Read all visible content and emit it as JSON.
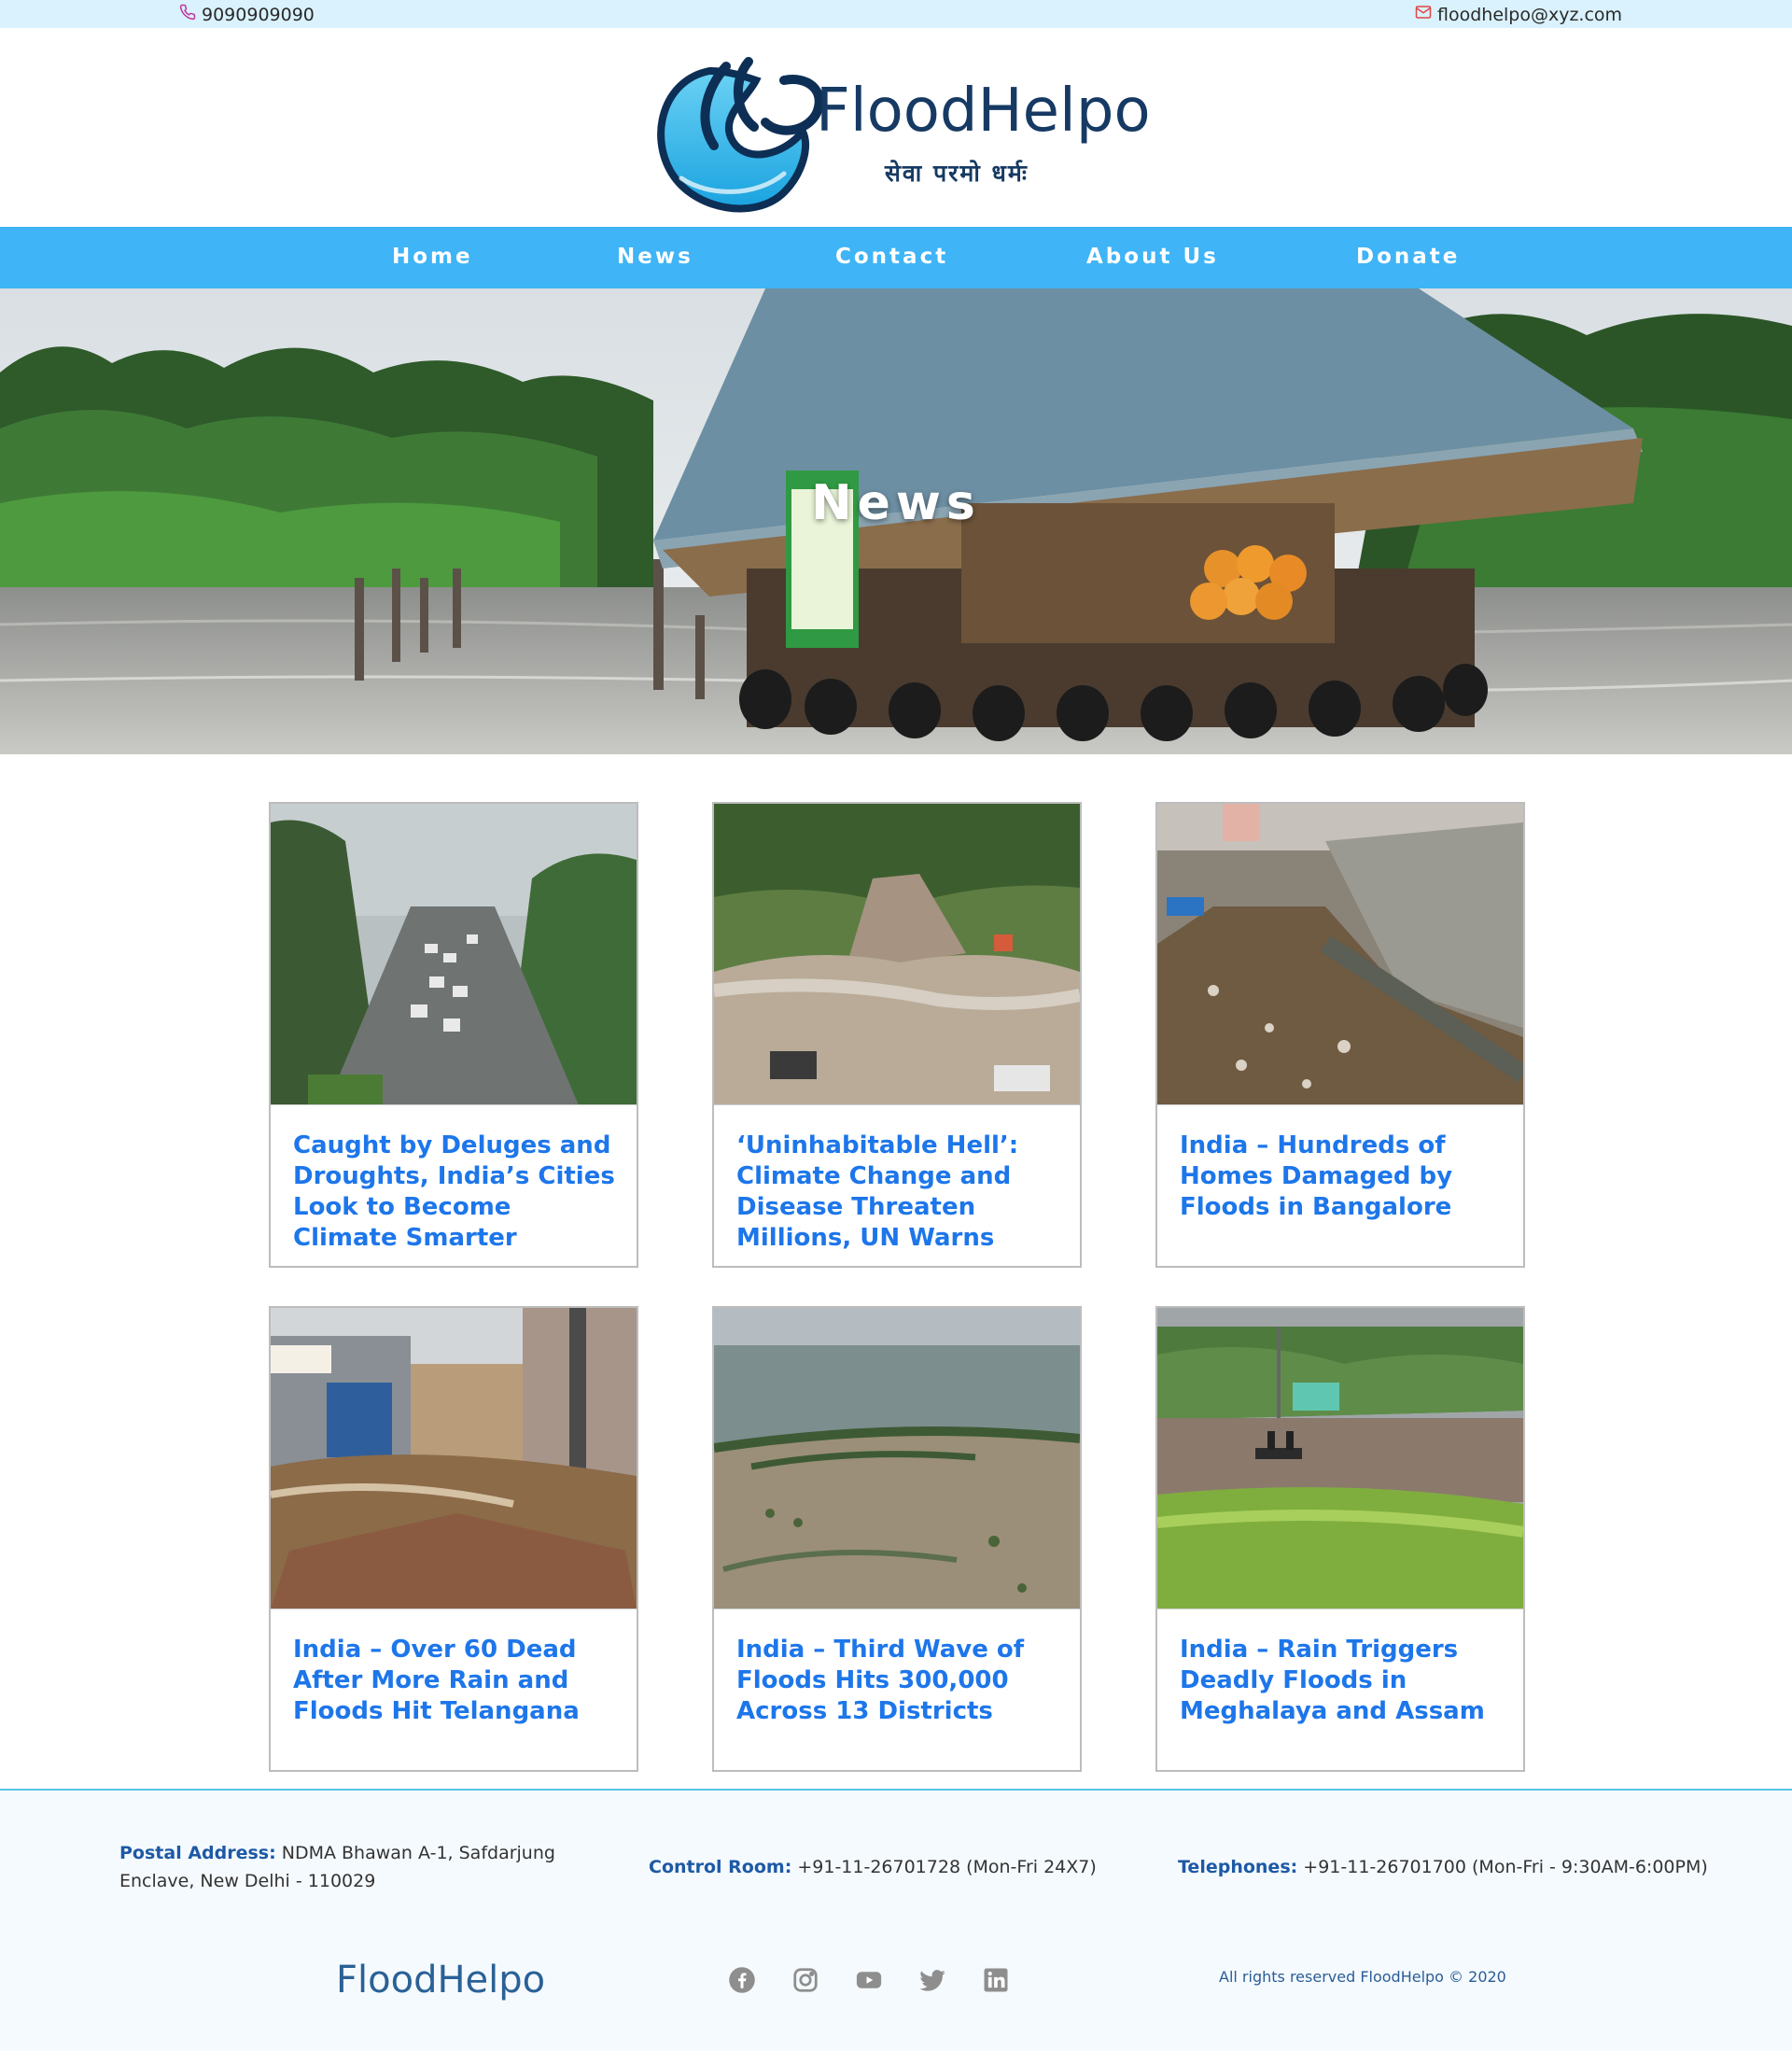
{
  "topbar": {
    "phone": "9090909090",
    "email": "floodhelpo@xyz.com"
  },
  "logo": {
    "name": "FloodHelpo",
    "tagline": "सेवा परमो धर्मः"
  },
  "nav": {
    "items": [
      "Home",
      "News",
      "Contact",
      "About Us",
      "Donate"
    ]
  },
  "hero": {
    "title": "News"
  },
  "news": [
    {
      "title": "Caught by Deluges and Droughts, India’s Cities Look to Become Climate Smarter"
    },
    {
      "title": "‘Uninhabitable Hell’: Climate Change and Disease Threaten Millions, UN Warns"
    },
    {
      "title": "India – Hundreds of Homes Damaged by Floods in Bangalore"
    },
    {
      "title": "India – Over 60 Dead After More Rain and Floods Hit Telangana"
    },
    {
      "title": "India – Third Wave of Floods Hits 300,000 Across 13 Districts"
    },
    {
      "title": "India – Rain Triggers Deadly Floods in Meghalaya and Assam"
    }
  ],
  "footer": {
    "postal_label": "Postal Address:",
    "postal_value": "NDMA Bhawan A-1, Safdarjung Enclave, New Delhi - 110029",
    "control_label": "Control Room:",
    "control_value": "+91-11-26701728 (Mon-Fri 24X7)",
    "tel_label": "Telephones:",
    "tel_value": "+91-11-26701700 (Mon-Fri - 9:30AM-6:00PM)",
    "brand": "FloodHelpo",
    "copyright": "All rights reserved FloodHelpo © 2020",
    "socials": [
      "facebook-icon",
      "instagram-icon",
      "youtube-icon",
      "twitter-icon",
      "linkedin-icon"
    ]
  },
  "colors": {
    "topbar_bg": "#d9f2fd",
    "nav_bg": "#3fb4f6",
    "title_blue": "#1d76ea",
    "footer_label": "#1d59a6",
    "logo_navy": "#163a63"
  }
}
